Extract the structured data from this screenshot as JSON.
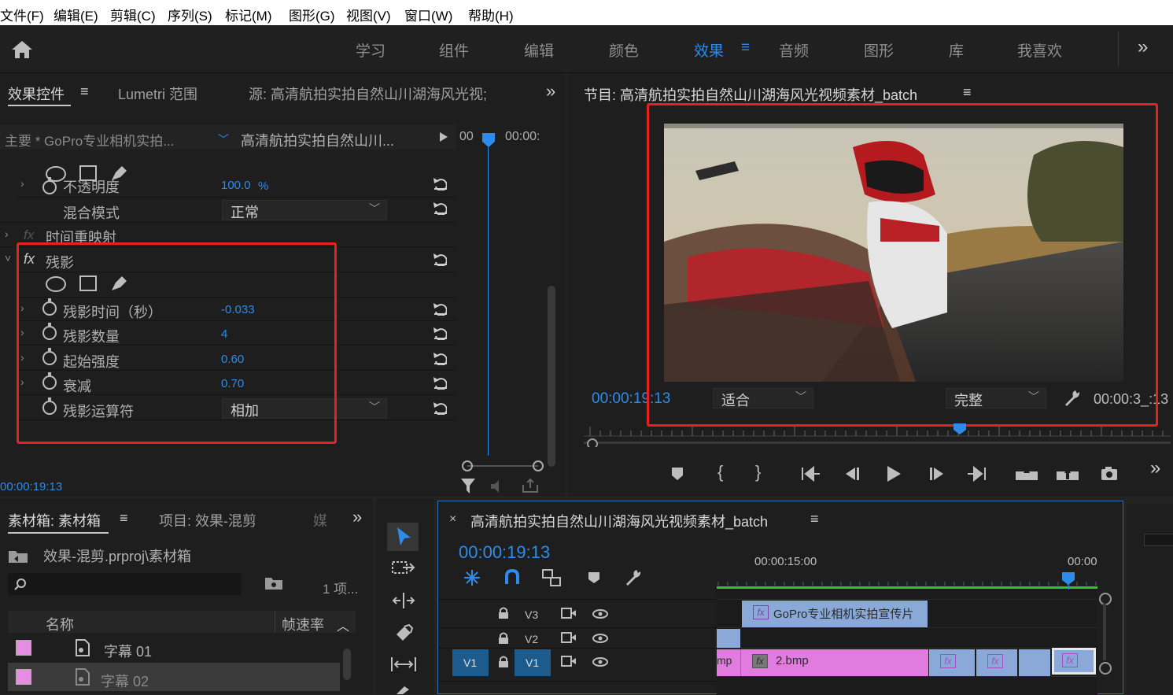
{
  "menu": [
    "文件(F)",
    "编辑(E)",
    "剪辑(C)",
    "序列(S)",
    "标记(M)",
    "图形(G)",
    "视图(V)",
    "窗口(W)",
    "帮助(H)"
  ],
  "workspaces": [
    "学习",
    "组件",
    "编辑",
    "颜色",
    "效果",
    "音频",
    "图形",
    "库",
    "我喜欢"
  ],
  "workspace_active": "效果",
  "workspace_menu_glyph": "≡",
  "more_glyph": "»",
  "effect_controls": {
    "tabs": [
      "效果控件",
      "Lumetri 范围",
      "源: 高清航拍实拍自然山川湖海风光视;"
    ],
    "menu_glyph": "≡",
    "master_clip": "主要 * GoPro专业相机实拍...",
    "sequence_clip": "高清航拍实拍自然山川...",
    "ruler_start": "00",
    "ruler_mark": "00:00:",
    "opacity_label": "不透明度",
    "opacity_value": "100.0",
    "opacity_unit": "%",
    "blend_label": "混合模式",
    "blend_value": "正常",
    "time_remap_label": "时间重映射",
    "echo_label": "残影",
    "echo_params": [
      {
        "label": "残影时间（秒）",
        "value": "-0.033"
      },
      {
        "label": "残影数量",
        "value": "4"
      },
      {
        "label": "起始强度",
        "value": "0.60"
      },
      {
        "label": "衰减",
        "value": "0.70"
      }
    ],
    "operator_label": "残影运算符",
    "operator_value": "相加",
    "timecode": "00:00:19:13"
  },
  "program": {
    "title": "节目: 高清航拍实拍自然山川湖海风光视频素材_batch",
    "menu_glyph": "≡",
    "timecode": "00:00:19:13",
    "fit": "适合",
    "quality": "完整",
    "duration": "00:00:3_:13"
  },
  "bin": {
    "tabs": [
      "素材箱: 素材箱",
      "项目: 效果-混剪",
      "媒"
    ],
    "menu_glyph": "≡",
    "path": "效果-混剪.prproj\\素材箱",
    "count": "1 项...",
    "col_name": "名称",
    "col_fps": "帧速率",
    "items": [
      {
        "name": "字幕 01",
        "color": "#e58ee1"
      },
      {
        "name": "字幕 02",
        "color": "#e58ee1"
      }
    ]
  },
  "timeline": {
    "close_glyph": "×",
    "title": "高清航拍实拍自然山川湖海风光视频素材_batch",
    "menu_glyph": "≡",
    "timecode": "00:00:19:13",
    "ruler_label_1": "00:00:15:00",
    "ruler_label_2": "00:00",
    "tracks": [
      {
        "name": "V3"
      },
      {
        "name": "V2"
      },
      {
        "name": "V1",
        "source": "V1"
      }
    ],
    "clip_v3": "GoPro专业相机实拍宣传片",
    "clip_v1_left": "mp",
    "clip_v1_main": "2.bmp",
    "fx_glyph": "fx"
  },
  "colors": {
    "accent": "#2d8ceb",
    "highlight_box": "#e5221f",
    "pink_clip": "#e27be0",
    "blue_clip": "#8aa9d8"
  }
}
